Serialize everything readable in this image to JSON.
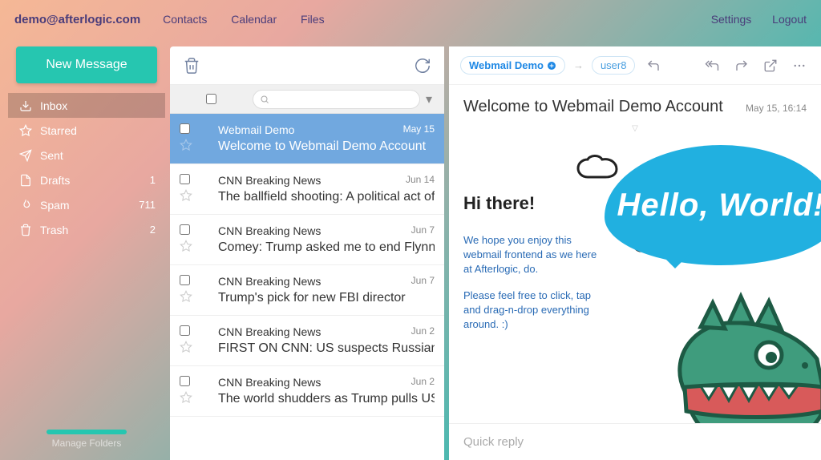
{
  "topbar": {
    "account": "demo@afterlogic.com",
    "nav": [
      "Contacts",
      "Calendar",
      "Files"
    ],
    "settings": "Settings",
    "logout": "Logout"
  },
  "compose_label": "New Message",
  "folders": [
    {
      "name": "Inbox",
      "icon": "inbox",
      "count": "",
      "selected": true
    },
    {
      "name": "Starred",
      "icon": "star",
      "count": ""
    },
    {
      "name": "Sent",
      "icon": "send",
      "count": ""
    },
    {
      "name": "Drafts",
      "icon": "file",
      "count": "1"
    },
    {
      "name": "Spam",
      "icon": "flame",
      "count": "711"
    },
    {
      "name": "Trash",
      "icon": "trash",
      "count": "2"
    }
  ],
  "manage_folders": "Manage Folders",
  "search_placeholder": "",
  "messages": [
    {
      "from": "Webmail Demo",
      "date": "May 15",
      "subject": "Welcome to Webmail Demo Account",
      "selected": true
    },
    {
      "from": "CNN Breaking News",
      "date": "Jun 14",
      "subject": "The ballfield shooting: A political act of violence"
    },
    {
      "from": "CNN Breaking News",
      "date": "Jun 7",
      "subject": "Comey: Trump asked me to end Flynn probe"
    },
    {
      "from": "CNN Breaking News",
      "date": "Jun 7",
      "subject": "Trump's pick for new FBI director"
    },
    {
      "from": "CNN Breaking News",
      "date": "Jun 2",
      "subject": "FIRST ON CNN: US suspects Russian hacking"
    },
    {
      "from": "CNN Breaking News",
      "date": "Jun 2",
      "subject": "The world shudders as Trump pulls US"
    }
  ],
  "preview": {
    "sender_chip": "Webmail Demo",
    "recipient_chip": "user8",
    "subject": "Welcome to Webmail Demo Account",
    "date": "May 15, 16:14",
    "heading": "Hi there!",
    "para1": "We hope you enjoy this webmail frontend as we here at Afterlogic, do.",
    "para2": "Please feel free to click, tap and drag-n-drop everything around. :)",
    "speech": "Hello, World!",
    "quick_reply_placeholder": "Quick reply"
  }
}
